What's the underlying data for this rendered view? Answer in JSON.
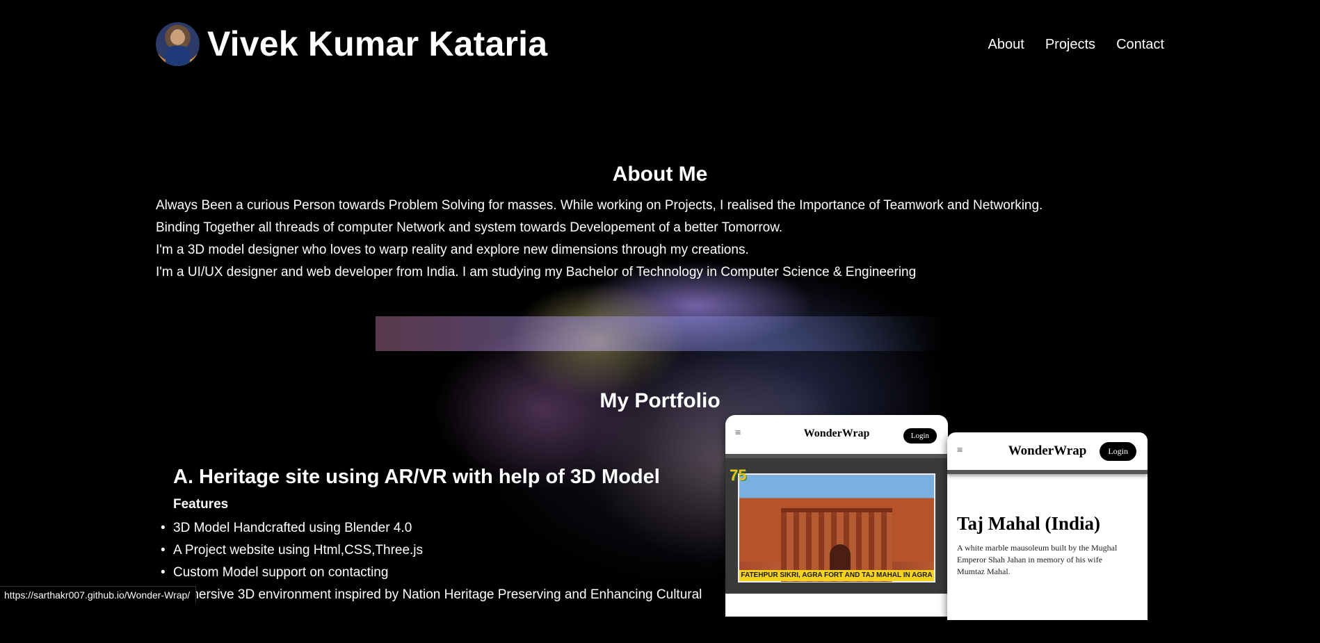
{
  "header": {
    "title": "Vivek Kumar Kataria",
    "nav": [
      {
        "label": "About"
      },
      {
        "label": "Projects"
      },
      {
        "label": "Contact"
      }
    ]
  },
  "about": {
    "title": "About Me",
    "lines": [
      "Always Been a curious Person towards Problem Solving for masses. While working on Projects, I realised the Importance of Teamwork and Networking.",
      "Binding Together all threads of computer Network and system towards Developement of a better Tomorrow.",
      "I'm a 3D model designer who loves to warp reality and explore new dimensions through my creations.",
      "I'm a UI/UX designer and web developer from India. I am studying my Bachelor of Technology in Computer Science & Engineering"
    ]
  },
  "portfolio": {
    "title": "My Portfolio",
    "project": {
      "title": "A. Heritage site using AR/VR with help of 3D Model",
      "features_label": "Features",
      "features": [
        "3D Model Handcrafted using Blender 4.0",
        "A Project website using Html,CSS,Three.js",
        "Custom Model support on contacting",
        "Immersive 3D environment inspired by Nation Heritage Preserving and Enhancing Cultural"
      ]
    },
    "mockups": {
      "phone_a": {
        "brand": "WonderWrap",
        "login": "Login",
        "menu_icon": "≡",
        "logo_text": "75",
        "photo_caption": "FATEHPUR SIKRI, AGRA FORT AND TAJ MAHAL IN AGRA"
      },
      "phone_b": {
        "brand": "WonderWrap",
        "login": "Login",
        "menu_icon": "≡",
        "heading": "Taj Mahal (India)",
        "description": "A white marble mausoleum built by the Mughal Emperor Shah Jahan in memory of his wife Mumtaz Mahal."
      }
    }
  },
  "status_bar": {
    "url": "https://sarthakr007.github.io/Wonder-Wrap/"
  },
  "colors": {
    "background": "#000000",
    "text": "#ffffff",
    "caption_yellow": "#f4d21f"
  }
}
